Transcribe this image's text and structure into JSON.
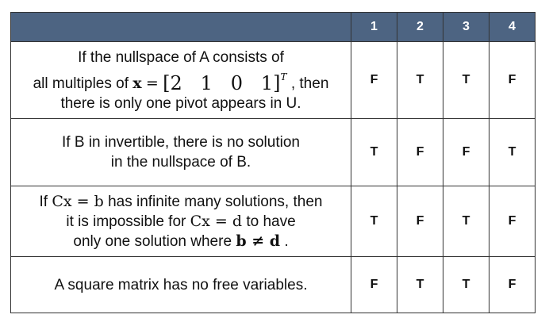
{
  "header": {
    "statement": "",
    "options": [
      "1",
      "2",
      "3",
      "4"
    ]
  },
  "rows": [
    {
      "line1": "If the nullspace of A consists of",
      "line2_pre": "all multiples of",
      "math_var": "x",
      "math_eq": "=",
      "math_vec": "[2   1   0   1]",
      "math_T": "T",
      "line2_post": ", then",
      "line3": "there is only one pivot appears in U.",
      "answers": [
        "F",
        "T",
        "T",
        "F"
      ]
    },
    {
      "line1": "If B in invertible, there is no solution",
      "line2": "in the nullspace of B.",
      "answers": [
        "T",
        "F",
        "F",
        "T"
      ]
    },
    {
      "line1_pre": "If",
      "math1": "Cx = b",
      "line1_post": "has infinite many solutions, then",
      "line2_pre": "it is impossible for",
      "math2": "Cx = d",
      "line2_post": "to have",
      "line3_pre": "only one solution where",
      "math3": "b ≠ d",
      "line3_post": ".",
      "answers": [
        "T",
        "F",
        "T",
        "F"
      ]
    },
    {
      "line1": "A square matrix has no free variables.",
      "answers": [
        "F",
        "T",
        "T",
        "F"
      ]
    }
  ],
  "colors": {
    "header_bg": "#4d6482",
    "header_text": "#ffffff",
    "border": "#333333"
  }
}
